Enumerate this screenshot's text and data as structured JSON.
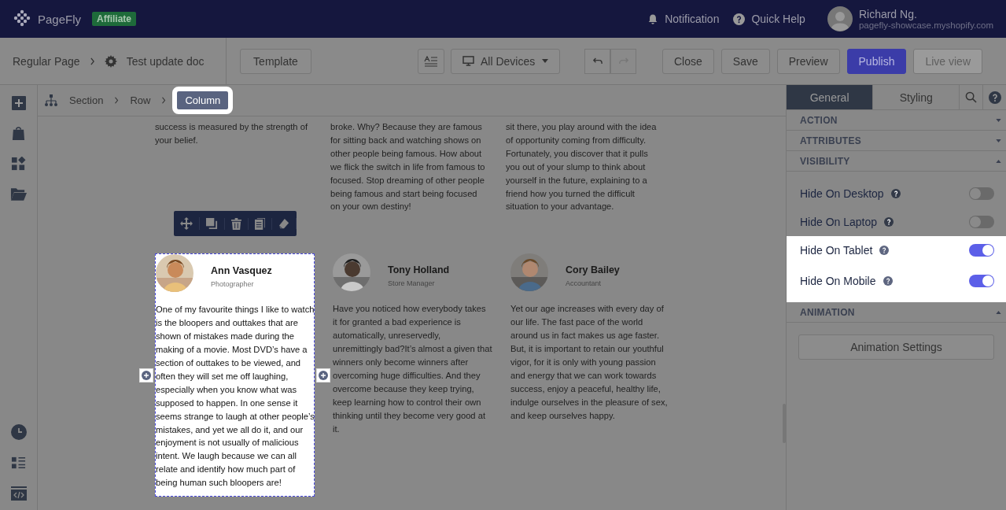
{
  "topbar": {
    "logo": "PageFly",
    "badge": "Affiliate",
    "notification": "Notification",
    "help": "Quick Help",
    "user": "Richard Ng.",
    "store": "pagefly-showcase.myshopify.com"
  },
  "toolbar": {
    "page_type": "Regular Page",
    "page_name": "Test update doc",
    "template": "Template",
    "device": "All Devices",
    "buttons": [
      {
        "label": "Close",
        "kind": "plain",
        "disabled": false
      },
      {
        "label": "Save",
        "kind": "plain",
        "disabled": false
      },
      {
        "label": "Preview",
        "kind": "plain",
        "disabled": false
      },
      {
        "label": "Publish",
        "kind": "primary",
        "disabled": false
      },
      {
        "label": "Live view",
        "kind": "plain",
        "disabled": true
      }
    ]
  },
  "breadcrumb": [
    {
      "label": "Section",
      "selected": false
    },
    {
      "label": "Row",
      "selected": false
    },
    {
      "label": "Column",
      "selected": true
    }
  ],
  "upper_texts": [
    "success is measured by the strength of your belief.",
    "broke. Why? Because they are famous for sitting back and watching shows on other people being famous. How about we flick the switch in life from famous to focused. Stop dreaming of other people being famous and start being focused on your own destiny!",
    "sit there, you play around with the idea of opportunity coming from difficulty. Fortunately, you discover that it pulls you out of your slump to think about yourself in the future, explaining to a friend how you turned the difficult situation to your advantage."
  ],
  "testimonials": [
    {
      "name": "Ann Vasquez",
      "role": "Photographer",
      "selected": true,
      "text": "One of my favourite things I like to watch is the bloopers and outtakes that are shown of mistakes made during the making of a movie. Most DVD’s have a section of outtakes to be viewed, and often they will set me off laughing, especially when you know what was supposed to happen. In one sense it seems strange to laugh at other people’s mistakes, and yet we all do it, and our enjoyment is not usually of malicious intent. We laugh because we can all relate and identify how much part of being human such bloopers are!"
    },
    {
      "name": "Tony Holland",
      "role": "Store Manager",
      "selected": false,
      "text": "Have you noticed how everybody takes it for granted a bad experience is automatically, unreservedly, unremittingly bad?It’s almost a given that winners only become winners after overcoming huge difficulties. And they overcome because they keep trying, keep learning how to control their own thinking until they become very good at it."
    },
    {
      "name": "Cory Bailey",
      "role": "Accountant",
      "selected": false,
      "text": "Yet our age increases with every day of our life. The fast pace of the world around us in fact makes us age faster. But, it is important to retain our youthful vigor, for it is only with young passion and energy that we can work towards success, enjoy a peaceful, healthy life, indulge ourselves in the pleasure of sex, and keep ourselves happy."
    }
  ],
  "panel": {
    "tabs": [
      {
        "label": "General",
        "selected": true
      },
      {
        "label": "Styling",
        "selected": false
      }
    ],
    "sections": [
      {
        "title": "ACTION",
        "expanded": false
      },
      {
        "title": "ATTRIBUTES",
        "expanded": false
      },
      {
        "title": "VISIBILITY",
        "expanded": true,
        "toggles": [
          {
            "label": "Hide On Desktop",
            "on": false
          },
          {
            "label": "Hide On Laptop",
            "on": false
          },
          {
            "label": "Hide On Tablet",
            "on": true
          },
          {
            "label": "Hide On Mobile",
            "on": true
          }
        ]
      },
      {
        "title": "ANIMATION",
        "expanded": true,
        "button": "Animation Settings"
      }
    ]
  }
}
